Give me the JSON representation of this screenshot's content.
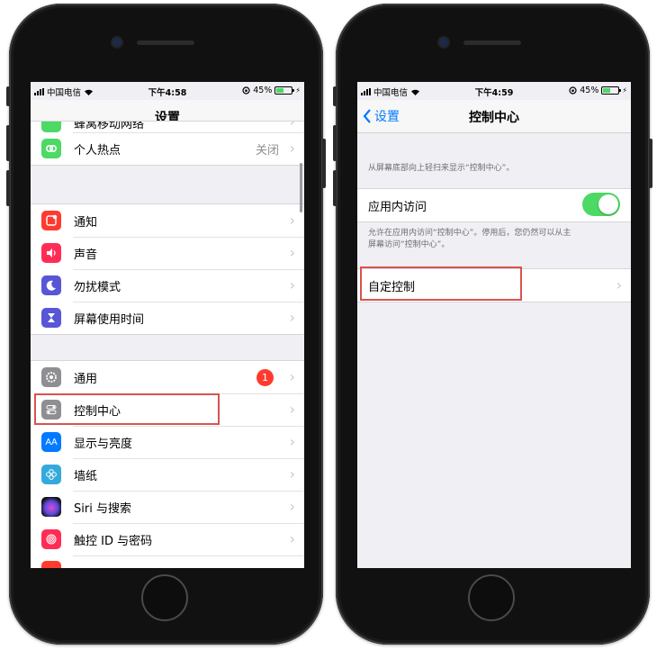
{
  "status_left": {
    "carrier": "中国电信",
    "time": "下午4:58",
    "battery": "45%"
  },
  "status_right": {
    "carrier": "中国电信",
    "time": "下午4:59",
    "battery": "45%"
  },
  "left_screen": {
    "title": "设置",
    "partial_top_item": "蜂窝移动网络",
    "group1": [
      {
        "label": "个人热点",
        "detail": "关闭",
        "icon": "link-icon",
        "color": "#4cd964"
      }
    ],
    "group2": [
      {
        "label": "通知",
        "icon": "notification-icon",
        "color": "#ff3b30"
      },
      {
        "label": "声音",
        "icon": "speaker-icon",
        "color": "#ff2d55"
      },
      {
        "label": "勿扰模式",
        "icon": "moon-icon",
        "color": "#5856d6"
      },
      {
        "label": "屏幕使用时间",
        "icon": "hourglass-icon",
        "color": "#5856d6"
      }
    ],
    "group3": [
      {
        "label": "通用",
        "badge": "1",
        "icon": "gear-icon",
        "color": "#8e8e93"
      },
      {
        "label": "控制中心",
        "icon": "toggles-icon",
        "color": "#8e8e93"
      },
      {
        "label": "显示与亮度",
        "icon": "aa-icon",
        "glyph": "AA",
        "color": "#007aff"
      },
      {
        "label": "墙纸",
        "icon": "flower-icon",
        "color": "#34aadc"
      },
      {
        "label": "Siri 与搜索",
        "icon": "siri-icon",
        "color": "#222222"
      },
      {
        "label": "触控 ID 与密码",
        "icon": "fingerprint-icon",
        "color": "#ff2d55"
      }
    ]
  },
  "right_screen": {
    "back_label": "设置",
    "title": "控制中心",
    "caption_top": "从屏幕底部向上轻扫来显示“控制中心”。",
    "toggle_label": "应用内访问",
    "toggle_on": true,
    "caption_mid_1": "允许在应用内访问“控制中心”。停用后，您仍然可以从主",
    "caption_mid_2": "屏幕访问“控制中心”。",
    "custom_label": "自定控制"
  },
  "colors": {
    "accent": "#007aff",
    "toggle_on": "#4cd964",
    "highlight": "#d9534f"
  }
}
